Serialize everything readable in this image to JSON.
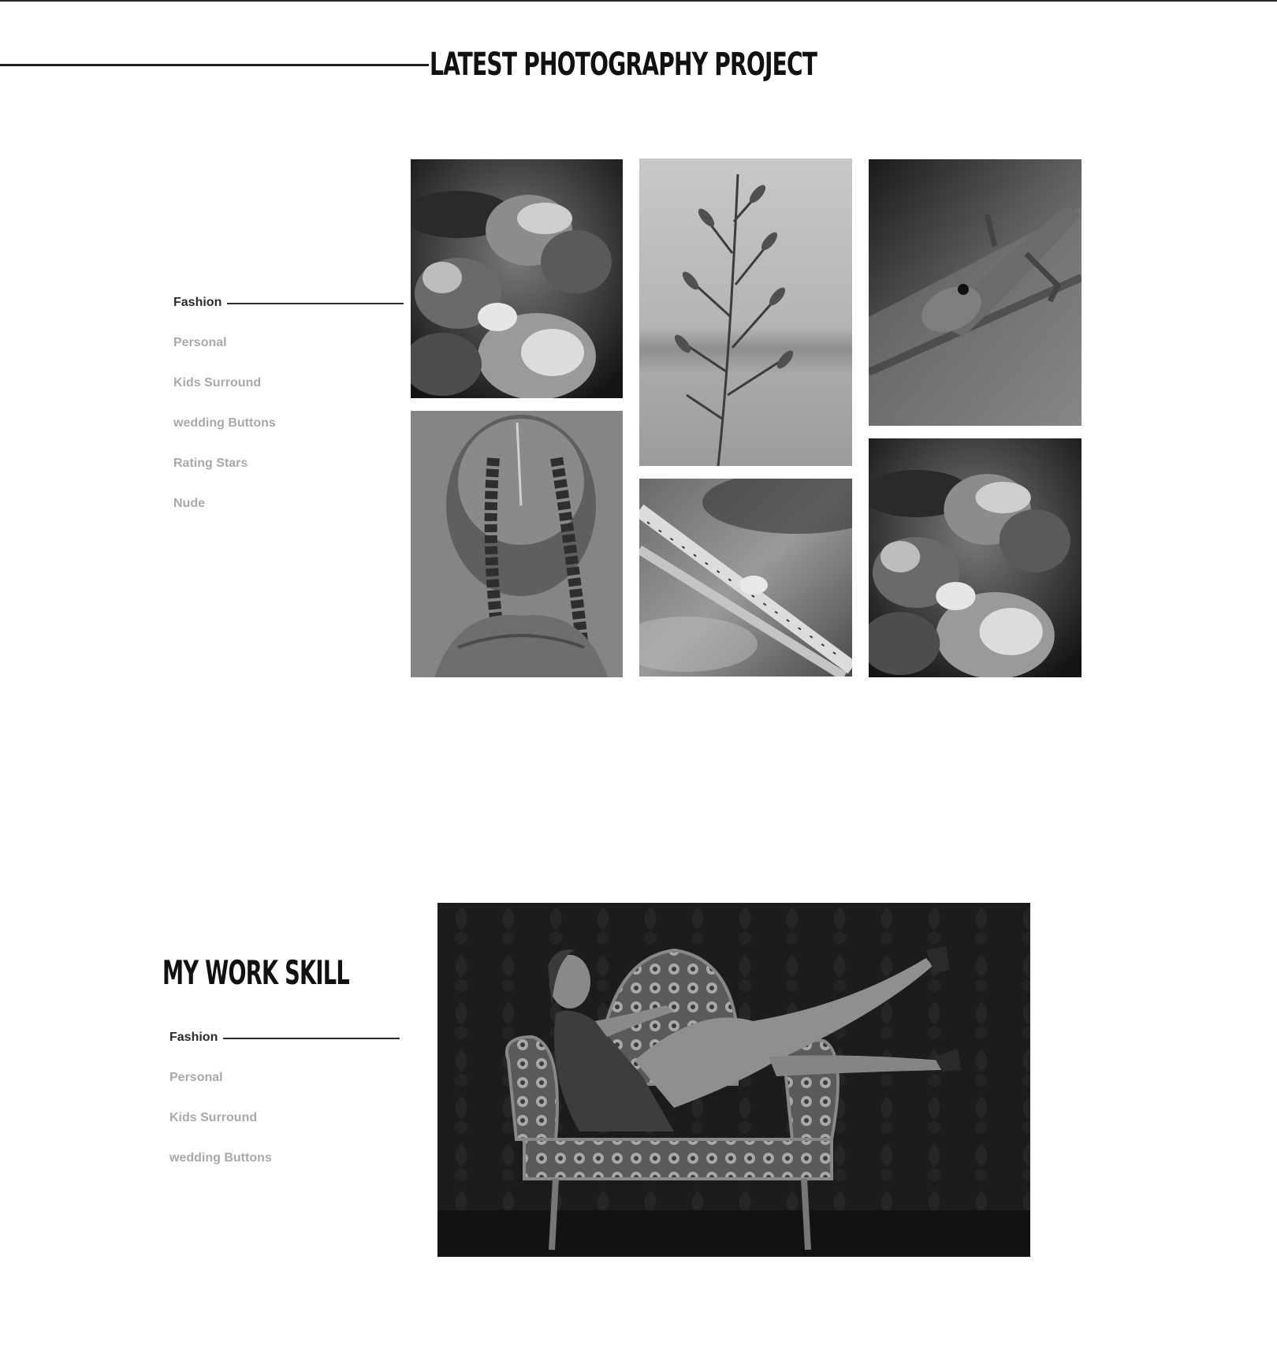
{
  "latest_section": {
    "title": "LATEST PHOTOGRAPHY PROJECT",
    "categories": [
      {
        "label": "Fashion",
        "active": true
      },
      {
        "label": "Personal",
        "active": false
      },
      {
        "label": "Kids Surround",
        "active": false
      },
      {
        "label": "wedding Buttons",
        "active": false
      },
      {
        "label": "Rating Stars",
        "active": false
      },
      {
        "label": "Nude",
        "active": false
      }
    ],
    "photos": [
      {
        "subject": "popcorn-closeup"
      },
      {
        "subject": "girl-braids"
      },
      {
        "subject": "grass-seed-head"
      },
      {
        "subject": "stick-macro"
      },
      {
        "subject": "lizard-on-bark"
      },
      {
        "subject": "popcorn-closeup"
      }
    ]
  },
  "skill_section": {
    "title": "MY WORK SKILL",
    "categories": [
      {
        "label": "Fashion",
        "active": true
      },
      {
        "label": "Personal",
        "active": false
      },
      {
        "label": "Kids Surround",
        "active": false
      },
      {
        "label": "wedding Buttons",
        "active": false
      }
    ],
    "photo": {
      "subject": "woman-reclining-on-ornate-chaise"
    }
  },
  "colors": {
    "text_dark": "#111111",
    "text_muted": "#a9a9a9",
    "line": "#1e1e1e",
    "background": "#ffffff"
  }
}
